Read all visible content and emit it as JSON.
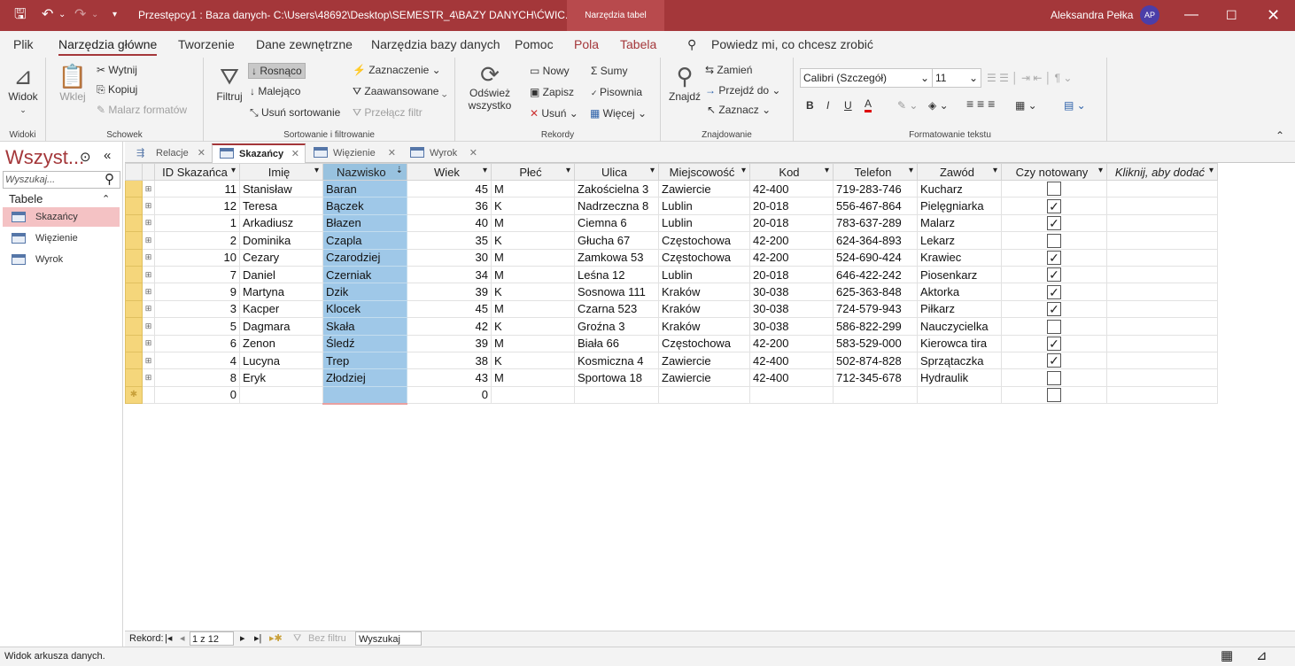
{
  "titlebar": {
    "title": "Przestępcy1 : Baza danych- C:\\Users\\48692\\Desktop\\SEMESTR_4\\BAZY DANYCH\\ĆWIC...",
    "context_tab": "Narzędzia tabel",
    "user": "Aleksandra Pełka",
    "initials": "AP"
  },
  "menu": {
    "tabs": [
      "Plik",
      "Narzędzia główne",
      "Tworzenie",
      "Dane zewnętrzne",
      "Narzędzia bazy danych",
      "Pomoc",
      "Pola",
      "Tabela"
    ],
    "tell_me": "Powiedz mi, co chcesz zrobić"
  },
  "ribbon": {
    "widoki": {
      "view": "Widok",
      "label": "Widoki"
    },
    "schowek": {
      "paste": "Wklej",
      "cut": "Wytnij",
      "copy": "Kopiuj",
      "painter": "Malarz formatów",
      "label": "Schowek"
    },
    "sort": {
      "filter": "Filtruj",
      "asc": "Rosnąco",
      "desc": "Malejąco",
      "remove": "Usuń sortowanie",
      "selection": "Zaznaczenie",
      "advanced": "Zaawansowane",
      "toggle": "Przełącz filtr",
      "label": "Sortowanie i filtrowanie"
    },
    "records": {
      "refresh1": "Odśwież",
      "refresh2": "wszystko",
      "new": "Nowy",
      "save": "Zapisz",
      "delete": "Usuń",
      "totals": "Sumy",
      "spelling": "Pisownia",
      "more": "Więcej",
      "label": "Rekordy"
    },
    "find": {
      "find": "Znajdź",
      "replace": "Zamień",
      "goto": "Przejdź do",
      "select": "Zaznacz",
      "label": "Znajdowanie"
    },
    "format": {
      "font": "Calibri (Szczegół)",
      "size": "11",
      "label": "Formatowanie tekstu"
    }
  },
  "nav": {
    "title": "Wszyst...",
    "search_placeholder": "Wyszukaj...",
    "section": "Tabele",
    "items": [
      "Skazańcy",
      "Więzienie",
      "Wyrok"
    ]
  },
  "object_tabs": [
    "Relacje",
    "Skazańcy",
    "Więzienie",
    "Wyrok"
  ],
  "table": {
    "columns": [
      "ID Skazańca",
      "Imię",
      "Nazwisko",
      "Wiek",
      "Płeć",
      "Ulica",
      "Miejscowość",
      "Kod",
      "Telefon",
      "Zawód",
      "Czy notowany",
      "Kliknij, aby dodać"
    ],
    "rows": [
      [
        "11",
        "Stanisław",
        "Baran",
        "45",
        "M",
        "Zakościelna 3",
        "Zawiercie",
        "42-400",
        "719-283-746",
        "Kucharz",
        false
      ],
      [
        "12",
        "Teresa",
        "Bączek",
        "36",
        "K",
        "Nadrzeczna 8",
        "Lublin",
        "20-018",
        "556-467-864",
        "Pielęgniarka",
        true
      ],
      [
        "1",
        "Arkadiusz",
        "Błazen",
        "40",
        "M",
        "Ciemna 6",
        "Lublin",
        "20-018",
        "783-637-289",
        "Malarz",
        true
      ],
      [
        "2",
        "Dominika",
        "Czapla",
        "35",
        "K",
        "Głucha 67",
        "Częstochowa",
        "42-200",
        "624-364-893",
        "Lekarz",
        false
      ],
      [
        "10",
        "Cezary",
        "Czarodziej",
        "30",
        "M",
        "Zamkowa 53",
        "Częstochowa",
        "42-200",
        "524-690-424",
        "Krawiec",
        true
      ],
      [
        "7",
        "Daniel",
        "Czerniak",
        "34",
        "M",
        "Leśna 12",
        "Lublin",
        "20-018",
        "646-422-242",
        "Piosenkarz",
        true
      ],
      [
        "9",
        "Martyna",
        "Dzik",
        "39",
        "K",
        "Sosnowa 111",
        "Kraków",
        "30-038",
        "625-363-848",
        "Aktorka",
        true
      ],
      [
        "3",
        "Kacper",
        "Klocek",
        "45",
        "M",
        "Czarna 523",
        "Kraków",
        "30-038",
        "724-579-943",
        "Piłkarz",
        true
      ],
      [
        "5",
        "Dagmara",
        "Skała",
        "42",
        "K",
        "Groźna 3",
        "Kraków",
        "30-038",
        "586-822-299",
        "Nauczycielka",
        false
      ],
      [
        "6",
        "Zenon",
        "Śledź",
        "39",
        "M",
        "Biała 66",
        "Częstochowa",
        "42-200",
        "583-529-000",
        "Kierowca tira",
        true
      ],
      [
        "4",
        "Lucyna",
        "Trep",
        "38",
        "K",
        "Kosmiczna 4",
        "Zawiercie",
        "42-400",
        "502-874-828",
        "Sprzątaczka",
        true
      ],
      [
        "8",
        "Eryk",
        "Złodziej",
        "43",
        "M",
        "Sportowa 18",
        "Zawiercie",
        "42-400",
        "712-345-678",
        "Hydraulik",
        false
      ]
    ],
    "new_row": {
      "id": "0",
      "age": "0"
    }
  },
  "recnav": {
    "label": "Rekord:",
    "position": "1 z 12",
    "nofilter": "Bez filtru",
    "search": "Wyszukaj"
  },
  "status": {
    "text": "Widok arkusza danych."
  }
}
